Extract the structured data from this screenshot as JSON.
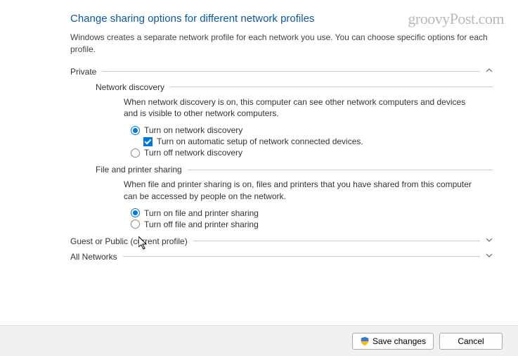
{
  "watermark": "groovyPost.com",
  "title": "Change sharing options for different network profiles",
  "intro": "Windows creates a separate network profile for each network you use. You can choose specific options for each profile.",
  "sections": {
    "private": {
      "label": "Private",
      "expanded": true,
      "network_discovery": {
        "label": "Network discovery",
        "desc": "When network discovery is on, this computer can see other network computers and devices and is visible to other network computers.",
        "opt_on": "Turn on network discovery",
        "opt_auto": "Turn on automatic setup of network connected devices.",
        "opt_off": "Turn off network discovery"
      },
      "file_printer": {
        "label": "File and printer sharing",
        "desc": "When file and printer sharing is on, files and printers that you have shared from this computer can be accessed by people on the network.",
        "opt_on": "Turn on file and printer sharing",
        "opt_off": "Turn off file and printer sharing"
      }
    },
    "guest": {
      "label": "Guest or Public (current profile)"
    },
    "all": {
      "label": "All Networks"
    }
  },
  "footer": {
    "save": "Save changes",
    "cancel": "Cancel"
  }
}
